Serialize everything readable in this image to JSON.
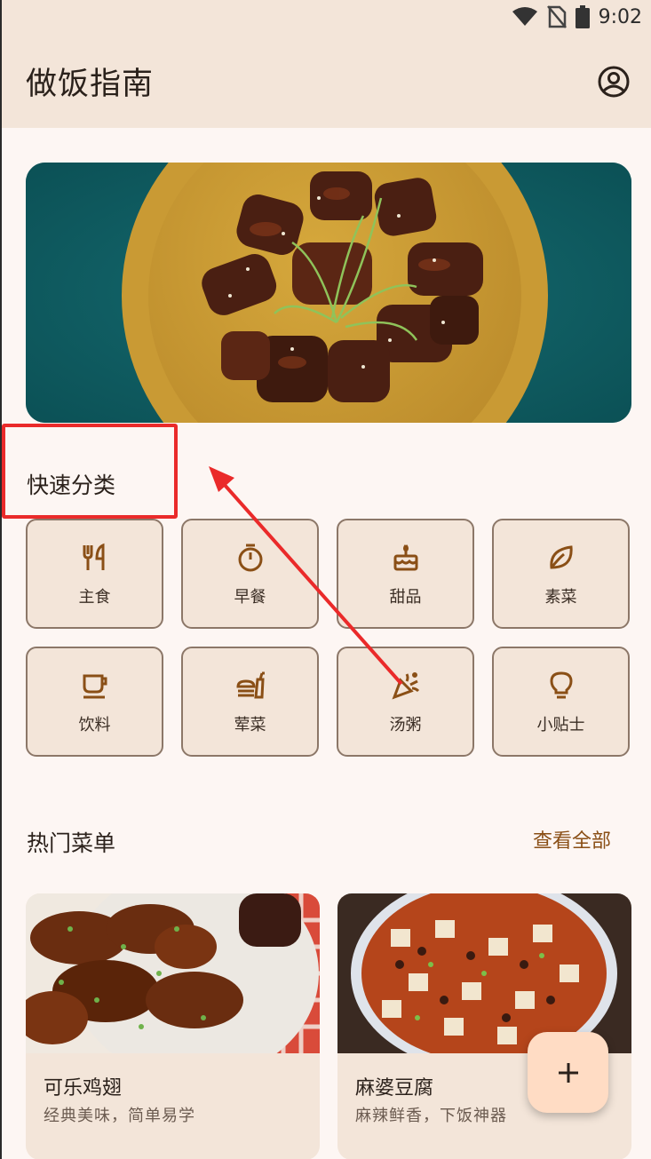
{
  "status_bar": {
    "time": "9:02",
    "icons": [
      "wifi-icon",
      "no-sim-icon",
      "battery-icon"
    ]
  },
  "app_bar": {
    "title": "做饭指南",
    "profile_icon": "account-circle-icon"
  },
  "hero": {
    "image": "braised-pork-ribs-on-yellow-plate"
  },
  "quick_categories": {
    "title": "快速分类",
    "items": [
      {
        "label": "主食",
        "icon": "utensils-icon"
      },
      {
        "label": "早餐",
        "icon": "timer-icon"
      },
      {
        "label": "甜品",
        "icon": "cake-icon"
      },
      {
        "label": "素菜",
        "icon": "leaf-icon"
      },
      {
        "label": "饮料",
        "icon": "cup-icon"
      },
      {
        "label": "荤菜",
        "icon": "burger-drink-icon"
      },
      {
        "label": "汤粥",
        "icon": "party-popper-icon"
      },
      {
        "label": "小贴士",
        "icon": "lightbulb-icon"
      }
    ]
  },
  "popular": {
    "title": "热门菜单",
    "see_all": "查看全部",
    "cards": [
      {
        "title": "可乐鸡翅",
        "subtitle": "经典美味，简单易学",
        "image": "cola-chicken-wings"
      },
      {
        "title": "麻婆豆腐",
        "subtitle": "麻辣鲜香，下饭神器",
        "image": "mapo-tofu"
      }
    ]
  },
  "fab": {
    "label": "+"
  },
  "colors": {
    "accent": "#8a4f16",
    "surface": "#f3e5d9",
    "background": "#fdf6f3",
    "annotation": "#ea2a2a"
  }
}
